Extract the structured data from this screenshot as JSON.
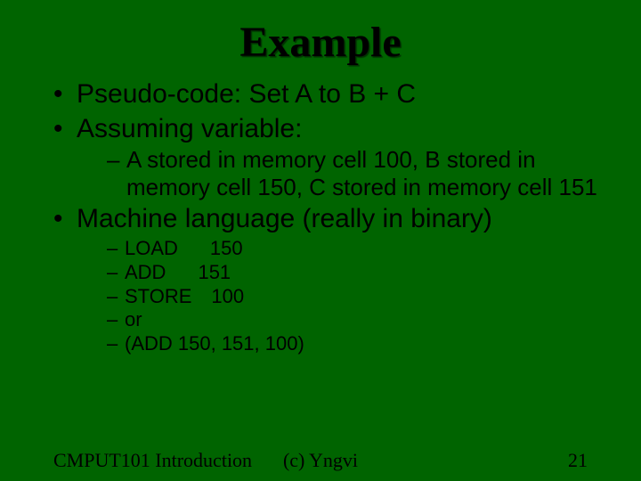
{
  "title": "Example",
  "bullets": {
    "b1": "Pseudo-code: Set A to B + C",
    "b2": "Assuming variable:",
    "b2_sub1": "A stored in memory cell 100, B stored in memory cell 150,  C stored in memory cell 151",
    "b3": "Machine language (really in binary)",
    "b3_sub1_op": "LOAD",
    "b3_sub1_arg": "150",
    "b3_sub2_op": "ADD",
    "b3_sub2_arg": "151",
    "b3_sub3_op": "STORE",
    "b3_sub3_arg": "100",
    "b3_sub4": "or",
    "b3_sub5": "(ADD    150, 151, 100)"
  },
  "footer": {
    "left": "CMPUT101 Introduction",
    "center": "(c) Yngvi",
    "right": "21"
  }
}
